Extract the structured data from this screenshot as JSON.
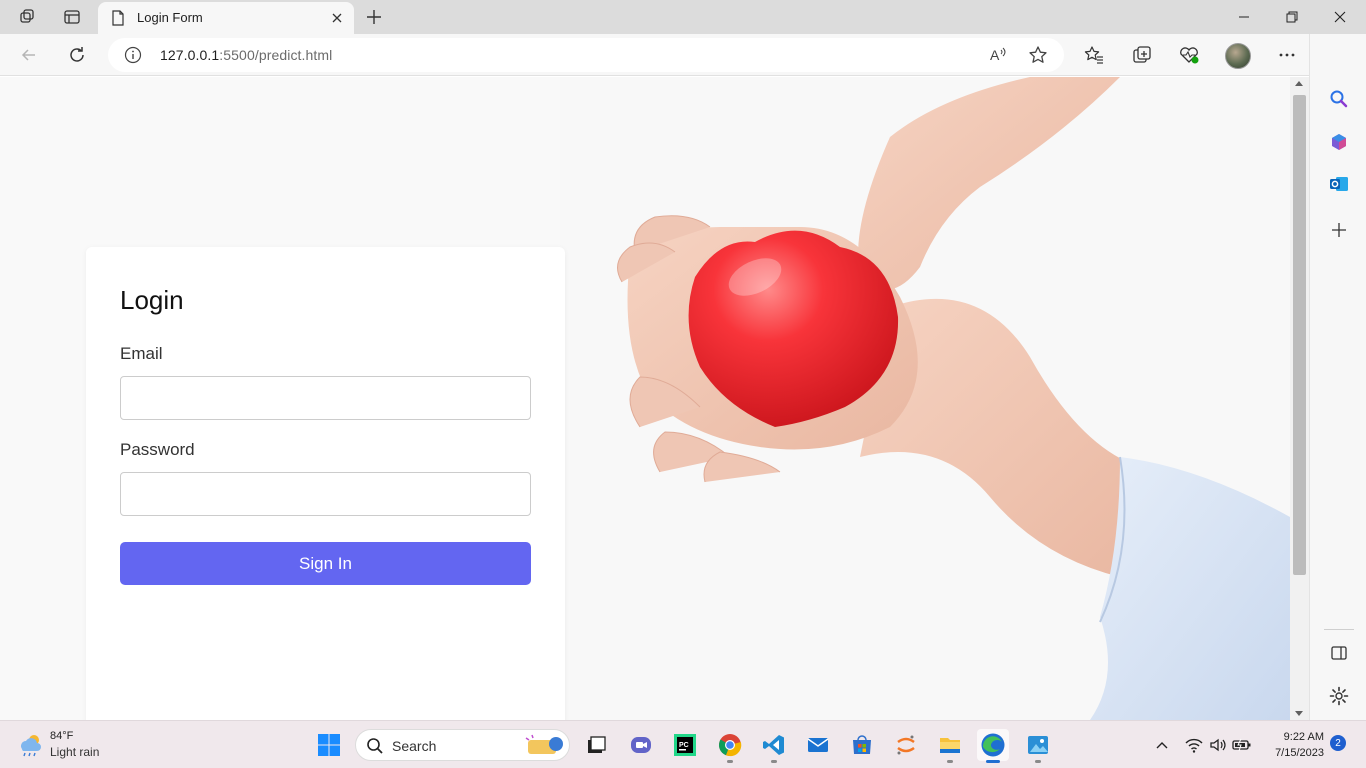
{
  "browser": {
    "tab": {
      "title": "Login Form"
    },
    "address": {
      "host": "127.0.0.1",
      "rest": ":5500/predict.html"
    }
  },
  "login": {
    "title": "Login",
    "email_label": "Email",
    "email_value": "",
    "password_label": "Password",
    "password_value": "",
    "signin_label": "Sign In"
  },
  "colors": {
    "accent": "#6366f1",
    "heart": "#e8232a",
    "edge_blue": "#1f6fd1"
  },
  "taskbar": {
    "weather": {
      "temp": "84°F",
      "condition": "Light rain"
    },
    "search_label": "Search",
    "clock": {
      "time": "9:22 AM",
      "date": "7/15/2023"
    },
    "notifications": "2",
    "apps": [
      "start-icon",
      "task-view-icon",
      "teams-icon",
      "pycharm-icon",
      "chrome-icon",
      "vscode-icon",
      "mail-icon",
      "store-icon",
      "jupyter-icon",
      "file-explorer-icon",
      "edge-icon",
      "photos-icon"
    ]
  }
}
